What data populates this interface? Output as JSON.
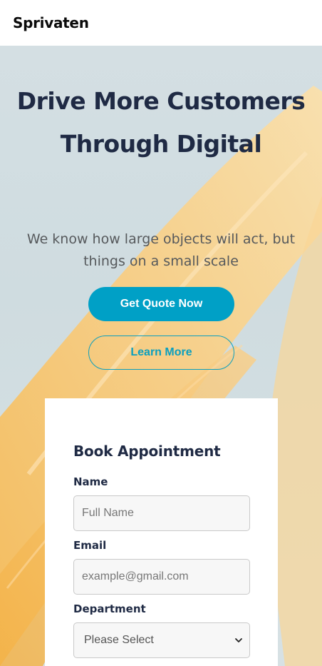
{
  "header": {
    "brand": "Sprivaten"
  },
  "hero": {
    "title": "Drive More Customers Through Digital",
    "subtitle": "We know how large objects will act, but things on a small scale",
    "primary_button": "Get Quote Now",
    "secondary_button": "Learn More"
  },
  "appointment": {
    "title": "Book Appointment",
    "name_label": "Name",
    "name_placeholder": "Full Name",
    "email_label": "Email",
    "email_placeholder": "example@gmail.com",
    "department_label": "Department",
    "department_selected": "Please Select"
  },
  "colors": {
    "accent": "#00a0c6",
    "heading": "#1f2a44",
    "hero_bg": "#d4dfe3",
    "leaf": "#f8c870"
  },
  "icons": {
    "select_arrow": "chevron-down-icon"
  }
}
